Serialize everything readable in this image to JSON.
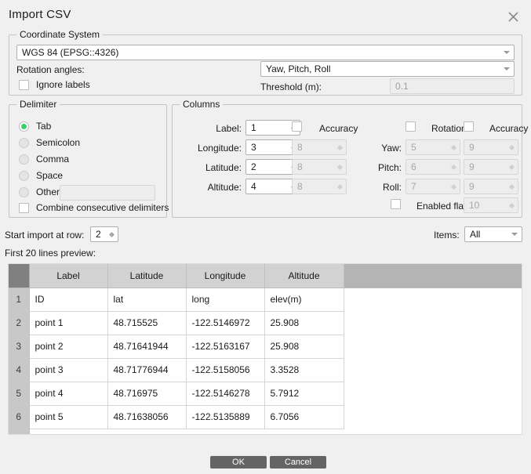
{
  "window": {
    "title": "Import CSV",
    "close_icon": "close-icon"
  },
  "coordinate_system": {
    "group_title": "Coordinate System",
    "crs_value": "WGS 84 (EPSG::4326)",
    "rotation_angles_label": "Rotation angles:",
    "rotation_angles_value": "Yaw, Pitch, Roll",
    "ignore_labels_label": "Ignore labels",
    "ignore_labels_checked": false,
    "threshold_label": "Threshold (m):",
    "threshold_value": "0.1",
    "threshold_enabled": false
  },
  "delimiter": {
    "group_title": "Delimiter",
    "options": [
      {
        "label": "Tab",
        "selected": true
      },
      {
        "label": "Semicolon",
        "selected": false
      },
      {
        "label": "Comma",
        "selected": false
      },
      {
        "label": "Space",
        "selected": false
      },
      {
        "label": "Other:",
        "selected": false
      }
    ],
    "other_value": "",
    "combine_label": "Combine consecutive delimiters",
    "combine_checked": false,
    "selected_color": "#35d06a"
  },
  "columns": {
    "group_title": "Columns",
    "left": [
      {
        "label": "Label:",
        "value": "1",
        "enabled": true
      },
      {
        "label": "Longitude:",
        "value": "3",
        "enabled": true
      },
      {
        "label": "Latitude:",
        "value": "2",
        "enabled": true
      },
      {
        "label": "Altitude:",
        "value": "4",
        "enabled": true
      }
    ],
    "accuracy_label": "Accuracy",
    "accuracy_checked": false,
    "accuracy_values": [
      "8",
      "8",
      "8"
    ],
    "rotation_label": "Rotation",
    "rotation_checked": false,
    "rotation_accuracy_label": "Accuracy",
    "rotation_accuracy_checked": false,
    "right": [
      {
        "label": "Yaw:",
        "value": "5",
        "accuracy": "9"
      },
      {
        "label": "Pitch:",
        "value": "6",
        "accuracy": "9"
      },
      {
        "label": "Roll:",
        "value": "7",
        "accuracy": "9"
      }
    ],
    "enabled_flag_label": "Enabled flag:",
    "enabled_flag_checked": false,
    "enabled_flag_value": "10"
  },
  "options_bar": {
    "start_row_label": "Start import at row:",
    "start_row_value": "2",
    "items_label": "Items:",
    "items_value": "All"
  },
  "preview": {
    "label": "First 20 lines preview:",
    "headers": [
      "Label",
      "Latitude",
      "Longitude",
      "Altitude"
    ],
    "rows": [
      {
        "num": "1",
        "cells": [
          "ID",
          "lat",
          "long",
          "elev(m)"
        ]
      },
      {
        "num": "2",
        "cells": [
          "point 1",
          "48.715525",
          "-122.5146972",
          "25.908"
        ]
      },
      {
        "num": "3",
        "cells": [
          "point 2",
          "48.71641944",
          "-122.5163167",
          "25.908"
        ]
      },
      {
        "num": "4",
        "cells": [
          "point 3",
          "48.71776944",
          "-122.5158056",
          "3.3528"
        ]
      },
      {
        "num": "5",
        "cells": [
          "point 4",
          "48.716975",
          "-122.5146278",
          "5.7912"
        ]
      },
      {
        "num": "6",
        "cells": [
          "point 5",
          "48.71638056",
          "-122.5135889",
          "6.7056"
        ]
      },
      {
        "num": "",
        "cells": [
          "",
          "",
          "",
          ""
        ]
      }
    ]
  },
  "footer": {
    "ok_label": "OK",
    "cancel_label": "Cancel"
  }
}
